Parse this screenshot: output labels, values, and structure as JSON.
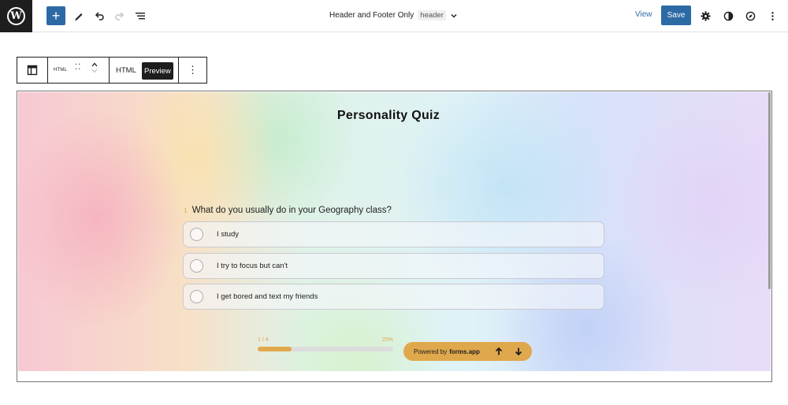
{
  "topbar": {
    "logo_glyph": "W",
    "add_icon": "+",
    "document_title": "Header and Footer Only",
    "document_badge": "header",
    "view_label": "View",
    "save_label": "Save"
  },
  "block_toolbar": {
    "html_small_label": "HTML",
    "tab_html_label": "HTML",
    "tab_preview_label": "Preview",
    "more_icon": "⋮"
  },
  "quiz": {
    "title": "Personality Quiz",
    "question_number": "1",
    "question_text": "What do you usually do in your Geography class?",
    "options": [
      {
        "label": "I study"
      },
      {
        "label": "I try to focus but can't"
      },
      {
        "label": "I get bored and text my friends"
      }
    ],
    "progress": {
      "step_text": "1 / 4",
      "percent_text": "25%",
      "fraction": 0.25
    },
    "powered_prefix": "Powered by",
    "powered_brand": "forms.app"
  },
  "colors": {
    "accent": "#2c6aa5",
    "quiz_accent": "#e0a84c",
    "dark": "#1e1e1e"
  },
  "icons": [
    "wordpress-logo-icon",
    "plus-icon",
    "pen-icon",
    "undo-icon",
    "redo-icon",
    "list-view-icon",
    "chevron-down-icon",
    "settings-icon",
    "contrast-icon",
    "compass-icon",
    "more-vertical-icon",
    "block-layout-icon",
    "drag-handle-icon",
    "move-up-icon",
    "move-down-icon",
    "arrow-up-icon",
    "arrow-down-icon"
  ]
}
